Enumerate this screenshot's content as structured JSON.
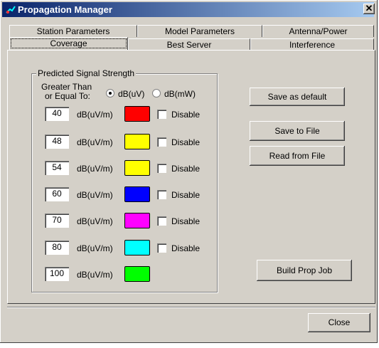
{
  "window": {
    "title": "Propagation Manager",
    "close_glyph": "✕"
  },
  "tabs_row1": [
    {
      "label": "Station Parameters"
    },
    {
      "label": "Model Parameters"
    },
    {
      "label": "Antenna/Power"
    }
  ],
  "tabs_row2": [
    {
      "label": "Coverage",
      "active": true
    },
    {
      "label": "Best Server"
    },
    {
      "label": "Interference"
    }
  ],
  "group": {
    "title": "Predicted Signal Strength",
    "threshold_label_1": "Greater Than",
    "threshold_label_2": "or Equal To:",
    "unit_options": [
      {
        "label": "dB(uV)",
        "selected": true
      },
      {
        "label": "dB(mW)",
        "selected": false
      }
    ],
    "rows": [
      {
        "value": "40",
        "unit": "dB(uV/m)",
        "color": "#ff0000",
        "disable_label": "Disable",
        "disabled": false
      },
      {
        "value": "48",
        "unit": "dB(uV/m)",
        "color": "#ffff00",
        "disable_label": "Disable",
        "disabled": false
      },
      {
        "value": "54",
        "unit": "dB(uV/m)",
        "color": "#ffff00",
        "disable_label": "Disable",
        "disabled": false
      },
      {
        "value": "60",
        "unit": "dB(uV/m)",
        "color": "#0000ff",
        "disable_label": "Disable",
        "disabled": false
      },
      {
        "value": "70",
        "unit": "dB(uV/m)",
        "color": "#ff00ff",
        "disable_label": "Disable",
        "disabled": false
      },
      {
        "value": "80",
        "unit": "dB(uV/m)",
        "color": "#00ffff",
        "disable_label": "Disable",
        "disabled": false
      },
      {
        "value": "100",
        "unit": "dB(uV/m)",
        "color": "#00ff00"
      }
    ]
  },
  "buttons": {
    "save_default": "Save as default",
    "save_file": "Save to File",
    "read_file": "Read from File",
    "build_job": "Build Prop Job",
    "close": "Close"
  }
}
